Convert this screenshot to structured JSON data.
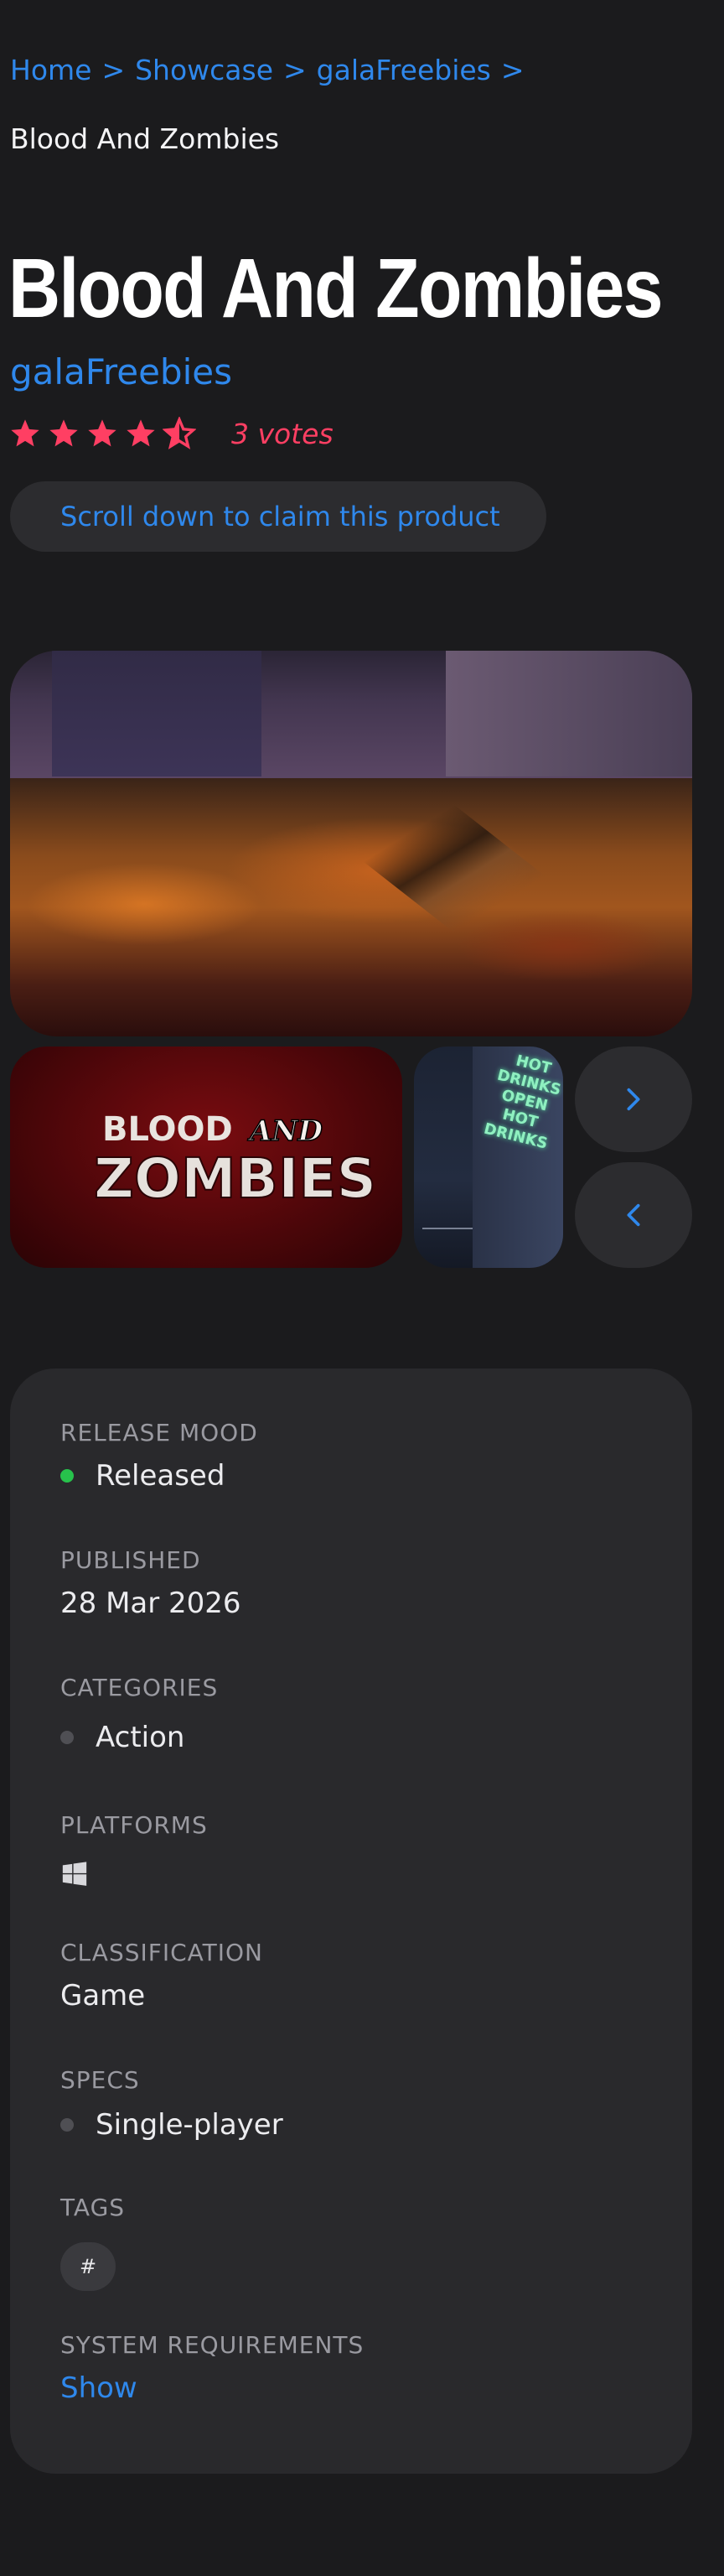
{
  "breadcrumb": {
    "items": [
      {
        "label": "Home"
      },
      {
        "label": "Showcase"
      },
      {
        "label": "galaFreebies"
      }
    ],
    "separator": ">",
    "current": "Blood And Zombies"
  },
  "product": {
    "title": "Blood And Zombies",
    "publisher": "galaFreebies",
    "rating": {
      "stars": 4.5,
      "max": 5,
      "votes_text": "3 votes",
      "star_color": "#ff3f63"
    },
    "claim_button_label": "Scroll down to claim this product"
  },
  "gallery": {
    "hero_alt": "gameplay-screenshot",
    "thumbnails": [
      {
        "name": "logo-thumbnail",
        "logo_line1": "BLOOD",
        "logo_and": "AND",
        "logo_line2": "ZOMBIES"
      },
      {
        "name": "screenshot-thumbnail",
        "neon_text": "HOT DRINKS OPEN HOT DRINKS"
      }
    ],
    "next_icon": "chevron-right-icon",
    "prev_icon": "chevron-left-icon"
  },
  "details": {
    "release_mood": {
      "label": "RELEASE MOOD",
      "value": "Released",
      "status_color": "#27c24c"
    },
    "published": {
      "label": "PUBLISHED",
      "value": "28 Mar 2026"
    },
    "categories": {
      "label": "CATEGORIES",
      "items": [
        "Action"
      ]
    },
    "platforms": {
      "label": "PLATFORMS",
      "icons": [
        "windows-icon"
      ]
    },
    "classification": {
      "label": "CLASSIFICATION",
      "value": "Game"
    },
    "specs": {
      "label": "SPECS",
      "items": [
        "Single-player"
      ]
    },
    "tags": {
      "label": "TAGS",
      "chip": "#"
    },
    "system_requirements": {
      "label": "SYSTEM REQUIREMENTS",
      "link": "Show"
    }
  },
  "colors": {
    "background": "#1b1b1d",
    "card": "#29292c",
    "accent_blue": "#2f88ec",
    "accent_pink": "#ff3f63"
  }
}
